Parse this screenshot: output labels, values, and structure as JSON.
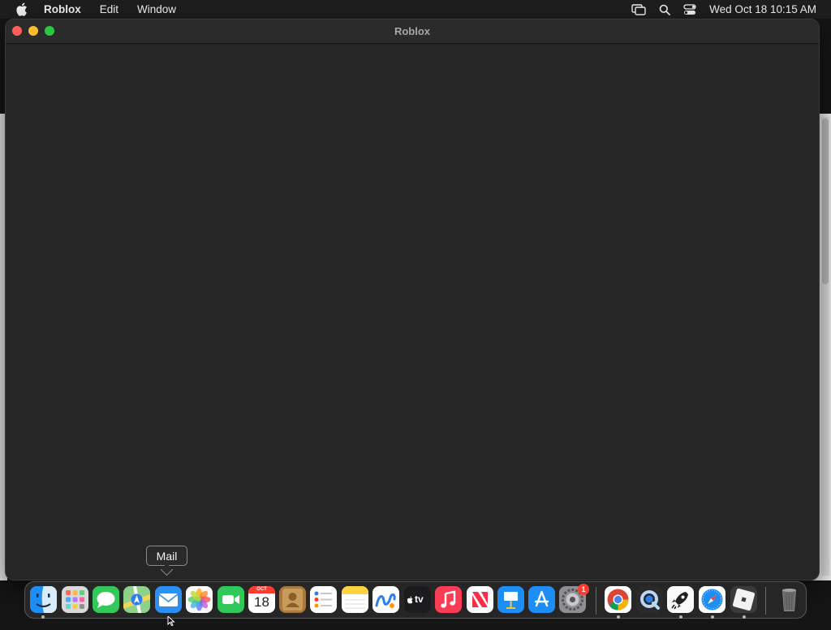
{
  "menubar": {
    "app_name": "Roblox",
    "menus": [
      "Edit",
      "Window"
    ],
    "clock": "Wed Oct 18  10:15 AM",
    "status_icons": [
      "screen-mirroring-icon",
      "spotlight-search-icon",
      "control-center-icon"
    ]
  },
  "window": {
    "title": "Roblox"
  },
  "tooltip": {
    "label": "Mail"
  },
  "dock": {
    "apps": [
      {
        "name": "Finder",
        "icon": "finder-icon",
        "running": true
      },
      {
        "name": "Launchpad",
        "icon": "launchpad-icon",
        "running": false
      },
      {
        "name": "Messages",
        "icon": "messages-icon",
        "running": false
      },
      {
        "name": "Maps",
        "icon": "maps-icon",
        "running": false
      },
      {
        "name": "Mail",
        "icon": "mail-icon",
        "running": false
      },
      {
        "name": "Photos",
        "icon": "photos-icon",
        "running": false
      },
      {
        "name": "FaceTime",
        "icon": "facetime-icon",
        "running": false
      },
      {
        "name": "Calendar",
        "icon": "calendar-icon",
        "running": false,
        "month": "OCT",
        "day": "18"
      },
      {
        "name": "Contacts",
        "icon": "contacts-icon",
        "running": false
      },
      {
        "name": "Reminders",
        "icon": "reminders-icon",
        "running": false
      },
      {
        "name": "Notes",
        "icon": "notes-icon",
        "running": false
      },
      {
        "name": "Freeform",
        "icon": "freeform-icon",
        "running": false
      },
      {
        "name": "TV",
        "icon": "apple-tv-icon",
        "running": false,
        "label": "tv"
      },
      {
        "name": "Music",
        "icon": "music-icon",
        "running": false
      },
      {
        "name": "News",
        "icon": "news-icon",
        "running": false
      },
      {
        "name": "Keynote",
        "icon": "keynote-icon",
        "running": false
      },
      {
        "name": "App Store",
        "icon": "app-store-icon",
        "running": false
      },
      {
        "name": "System Settings",
        "icon": "system-settings-icon",
        "running": false,
        "badge": "1"
      },
      {
        "name": "Chrome",
        "icon": "chrome-icon",
        "running": true
      },
      {
        "name": "QuickTime",
        "icon": "quicktime-icon",
        "running": false
      },
      {
        "name": "Rocket",
        "icon": "rocket-icon",
        "running": true
      },
      {
        "name": "Safari",
        "icon": "safari-icon",
        "running": true
      },
      {
        "name": "Roblox",
        "icon": "roblox-icon",
        "running": true
      },
      {
        "name": "Trash",
        "icon": "trash-icon",
        "running": false
      }
    ]
  }
}
